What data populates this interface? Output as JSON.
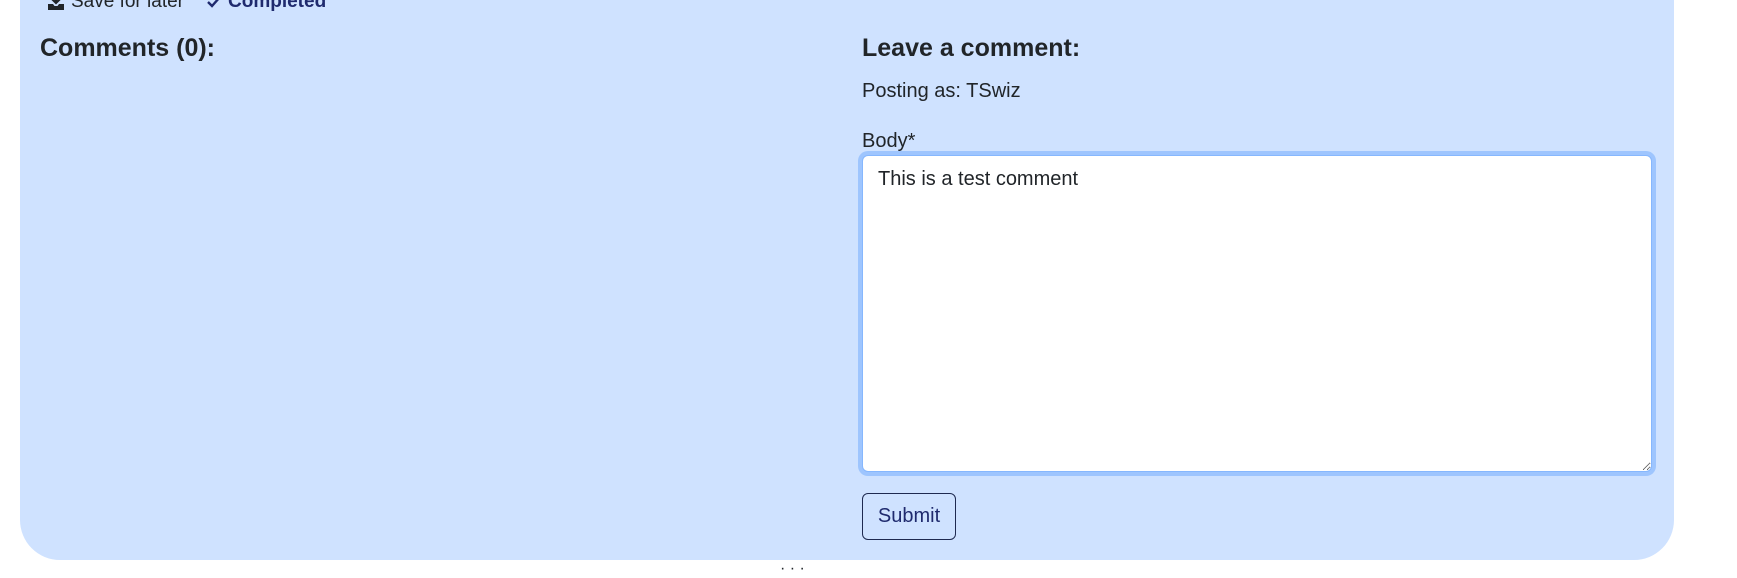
{
  "top_actions": {
    "save_label": "Save for later",
    "completed_label": "Completed"
  },
  "comments": {
    "heading": "Comments (0):"
  },
  "comment_form": {
    "heading": "Leave a comment:",
    "posting_as": "Posting as: TSwiz",
    "body_label": "Body*",
    "body_value": "This is a test comment",
    "submit_label": "Submit"
  },
  "footer": {
    "fragment": "· · ·"
  },
  "colors": {
    "panel_background": "#cfe2ff",
    "textarea_focus_border": "#86b7fe",
    "link_dark": "#1f2a6e"
  },
  "icons": {
    "save": "download-tray-icon",
    "completed": "check-icon"
  }
}
